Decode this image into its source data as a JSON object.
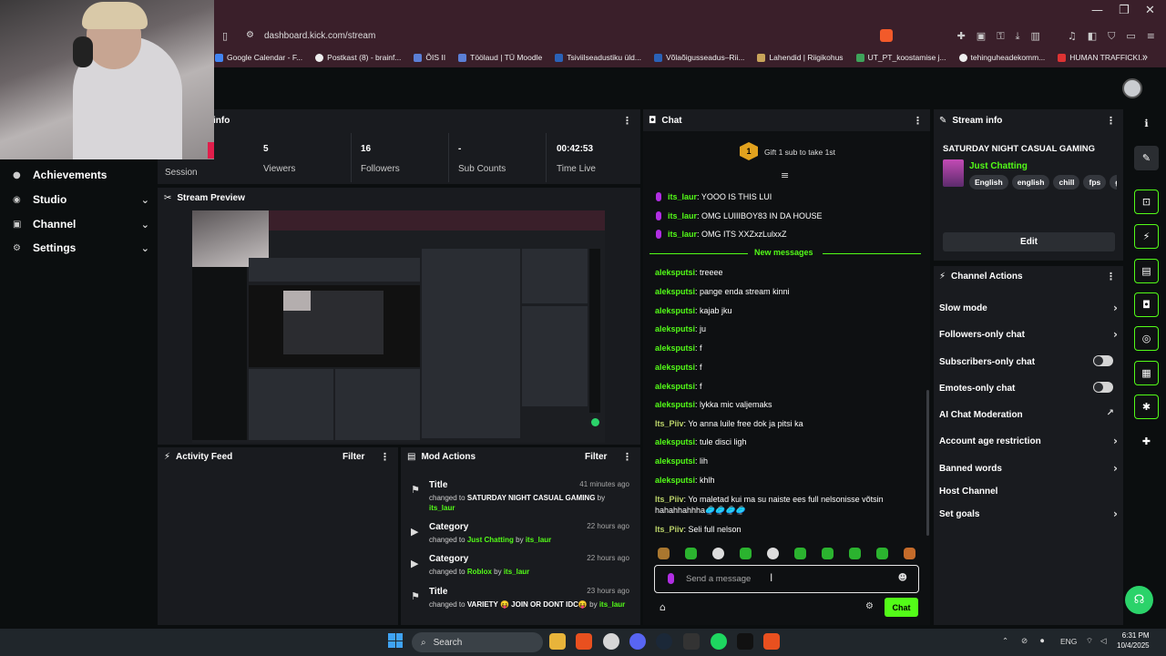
{
  "browser": {
    "url": "dashboard.kick.com/stream",
    "window_controls": [
      "—",
      "❐",
      "✕"
    ],
    "bookmarks": [
      {
        "label": "Google Calendar - F..."
      },
      {
        "label": "Postkast (8) - brainf..."
      },
      {
        "label": "ÕIS II"
      },
      {
        "label": "Töölaud | TÜ Moodle"
      },
      {
        "label": "Tsiviilseadustiku üld..."
      },
      {
        "label": "Võlaõigusseadus–Rii..."
      },
      {
        "label": "Lahendid | Riigikohus"
      },
      {
        "label": "UT_PT_koostamise j..."
      },
      {
        "label": "tehinguheadekomm..."
      },
      {
        "label": "HUMAN TRAFFICKI..."
      }
    ],
    "more_bookmarks": "»"
  },
  "sidebar": {
    "items": [
      {
        "label": "Achievements",
        "icon": "trophy-icon",
        "glyph": "●",
        "has_chevron": false
      },
      {
        "label": "Studio",
        "icon": "studio-icon",
        "glyph": "◉",
        "has_chevron": true
      },
      {
        "label": "Channel",
        "icon": "channel-icon",
        "glyph": "▣",
        "has_chevron": true
      },
      {
        "label": "Settings",
        "icon": "gear-icon",
        "glyph": "⚙",
        "has_chevron": true
      }
    ],
    "chevron": "⌄"
  },
  "session_info": {
    "title_partial": "info",
    "stats": [
      {
        "value": "",
        "label": "Session"
      },
      {
        "value": "5",
        "label": "Viewers"
      },
      {
        "value": "16",
        "label": "Followers"
      },
      {
        "value": "-",
        "label": "Sub Counts"
      },
      {
        "value": "00:42:53",
        "label": "Time Live"
      }
    ]
  },
  "stream_preview": {
    "title": "Stream Preview"
  },
  "activity_feed": {
    "title": "Activity Feed",
    "filter": "Filter"
  },
  "mod_actions": {
    "title": "Mod Actions",
    "filter": "Filter",
    "items": [
      {
        "title": "Title",
        "time": "41 minutes ago",
        "prefix": "changed to ",
        "value": "SATURDAY NIGHT CASUAL GAMING",
        "by": " by ",
        "user": "its_laur",
        "icon": "title-icon",
        "glyph": "⚑"
      },
      {
        "title": "Category",
        "time": "22 hours ago",
        "prefix": "changed to ",
        "value": "Just Chatting",
        "by": " by ",
        "user": "its_laur",
        "icon": "category-icon",
        "glyph": "▶"
      },
      {
        "title": "Category",
        "time": "22 hours ago",
        "prefix": "changed to ",
        "value": "Roblox",
        "by": " by ",
        "user": "its_laur",
        "icon": "category-icon",
        "glyph": "▶"
      },
      {
        "title": "Title",
        "time": "23 hours ago",
        "prefix": "changed to ",
        "value": "VARIETY 😝 JOIN OR DONT IDC😝",
        "by": " by ",
        "user": "its_laur",
        "icon": "title-icon",
        "glyph": "⚑"
      }
    ]
  },
  "chat": {
    "title": "Chat",
    "gift_badge": "1",
    "gift_text": "Gift 1 sub to take 1st",
    "new_messages": "New messages",
    "pinned": [
      {
        "user": "its_laur",
        "text": ": YOOO IS THIS LUI"
      },
      {
        "user": "its_laur",
        "text": ": OMG LUIIIBOY83 IN DA HOUSE"
      },
      {
        "user": "its_laur",
        "text": ": OMG ITS XXZxzLulxxZ"
      }
    ],
    "messages": [
      {
        "user": "aleksputsi",
        "text": ": treeee",
        "color": "green"
      },
      {
        "user": "aleksputsi",
        "text": ": pange enda stream kinni",
        "color": "green"
      },
      {
        "user": "aleksputsi",
        "text": ": kajab jku",
        "color": "green"
      },
      {
        "user": "aleksputsi",
        "text": ": ju",
        "color": "green"
      },
      {
        "user": "aleksputsi",
        "text": ": f",
        "color": "green"
      },
      {
        "user": "aleksputsi",
        "text": ": f",
        "color": "green"
      },
      {
        "user": "aleksputsi",
        "text": ": f",
        "color": "green"
      },
      {
        "user": "aleksputsi",
        "text": ": lykka mic valjemaks",
        "color": "green"
      },
      {
        "user": "Its_Piiv",
        "text": ": Yo anna luile free dok ja pitsi ka",
        "color": "olive"
      },
      {
        "user": "aleksputsi",
        "text": ": tule disci ligh",
        "color": "green"
      },
      {
        "user": "aleksputsi",
        "text": ": lih",
        "color": "green"
      },
      {
        "user": "aleksputsi",
        "text": ": khlh",
        "color": "green"
      },
      {
        "user": "Its_Piiv",
        "text": ": Yo maletad kui ma su naiste ees full nelsonisse võtsin hahahhahhha🥏🥏🥏🥏",
        "color": "olive"
      },
      {
        "user": "Its_Piiv",
        "text": ": Seli full nelson",
        "color": "olive"
      }
    ],
    "input_placeholder": "Send a message",
    "send_label": "Chat"
  },
  "stream_info": {
    "title": "Stream info",
    "stream_title": "SATURDAY NIGHT CASUAL GAMING",
    "category": "Just Chatting",
    "tags": [
      "English",
      "english",
      "chill",
      "fps",
      "ga"
    ],
    "edit_label": "Edit"
  },
  "channel_actions": {
    "title": "Channel Actions",
    "items": [
      {
        "label": "Slow mode",
        "control": "chevron"
      },
      {
        "label": "Followers-only chat",
        "control": "chevron"
      },
      {
        "label": "Subscribers-only chat",
        "control": "toggle"
      },
      {
        "label": "Emotes-only chat",
        "control": "toggle"
      },
      {
        "label": "AI Chat Moderation",
        "control": "external"
      },
      {
        "label": "Account age restriction",
        "control": "chevron"
      },
      {
        "label": "Banned words",
        "control": "chevron"
      },
      {
        "label": "Host Channel",
        "control": "none"
      },
      {
        "label": "Set goals",
        "control": "chevron"
      }
    ]
  },
  "right_rail": {
    "icons": [
      {
        "name": "info-icon",
        "glyph": "ℹ"
      },
      {
        "name": "edit-icon",
        "glyph": "✎"
      },
      {
        "name": "screenshot-icon",
        "glyph": "⊡"
      },
      {
        "name": "lightning-icon",
        "glyph": "⚡"
      },
      {
        "name": "clipboard-icon",
        "glyph": "▤"
      },
      {
        "name": "chat-bubble-icon",
        "glyph": "◘"
      },
      {
        "name": "broadcast-icon",
        "glyph": "◎"
      },
      {
        "name": "layout-icon",
        "glyph": "▦"
      },
      {
        "name": "wrench-icon",
        "glyph": "✱"
      },
      {
        "name": "more-icon",
        "glyph": "✚"
      }
    ]
  },
  "taskbar": {
    "search_label": "Search",
    "language": "ENG",
    "time": "6:31 PM",
    "date": "10/4/2025"
  },
  "colors": {
    "accent": "#53fc18",
    "panel": "#191b1f",
    "background": "#0b0e0f",
    "titlebar": "#3a1f2a"
  }
}
